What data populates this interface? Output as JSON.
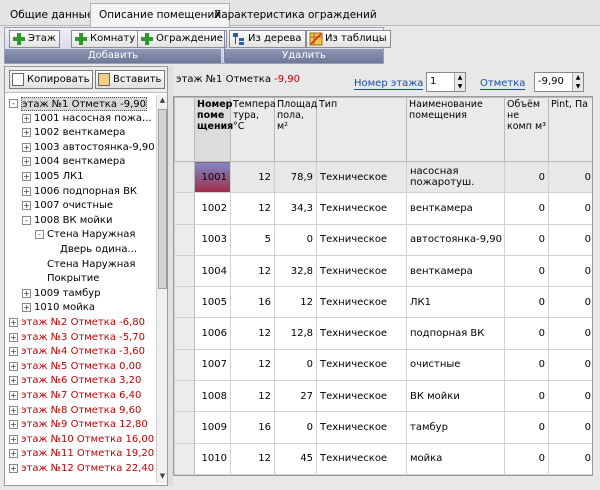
{
  "tabs": [
    {
      "label": "Общие данные"
    },
    {
      "label": "Описание помещений"
    },
    {
      "label": "Характеристика ограждений"
    }
  ],
  "ribbon": {
    "add_buttons": [
      "Этаж",
      "Комнату",
      "Ограждение"
    ],
    "add_group": "Добавить",
    "del_buttons": [
      "Из дерева",
      "Из таблицы"
    ],
    "del_group": "Удалить"
  },
  "left": {
    "copy": "Копировать",
    "paste": "Вставить"
  },
  "tree": [
    {
      "text": "этаж №1 Отметка -9,90",
      "red": false,
      "indent": 0,
      "exp": "-",
      "sel": true
    },
    {
      "text": "1001 насосная пожа...",
      "red": false,
      "indent": 1,
      "exp": "+"
    },
    {
      "text": "1002 венткамера",
      "red": false,
      "indent": 1,
      "exp": "+"
    },
    {
      "text": "1003 автостоянка-9,90",
      "red": false,
      "indent": 1,
      "exp": "+"
    },
    {
      "text": "1004 венткамера",
      "red": false,
      "indent": 1,
      "exp": "+"
    },
    {
      "text": "1005 ЛК1",
      "red": false,
      "indent": 1,
      "exp": "+"
    },
    {
      "text": "1006 подпорная ВК",
      "red": false,
      "indent": 1,
      "exp": "+"
    },
    {
      "text": "1007 очистные",
      "red": false,
      "indent": 1,
      "exp": "+"
    },
    {
      "text": "1008 ВК мойки",
      "red": false,
      "indent": 1,
      "exp": "-"
    },
    {
      "text": "Стена Наружная",
      "red": false,
      "indent": 2,
      "exp": "-"
    },
    {
      "text": "Дверь одина...",
      "red": false,
      "indent": 3,
      "exp": ""
    },
    {
      "text": "Стена Наружная",
      "red": false,
      "indent": 2,
      "exp": ""
    },
    {
      "text": "Покрытие",
      "red": false,
      "indent": 2,
      "exp": ""
    },
    {
      "text": "1009 тамбур",
      "red": false,
      "indent": 1,
      "exp": "+"
    },
    {
      "text": "1010 мойка",
      "red": false,
      "indent": 1,
      "exp": "+"
    },
    {
      "text": "этаж №2 Отметка -6,80",
      "red": true,
      "indent": 0,
      "exp": "+"
    },
    {
      "text": "этаж №3 Отметка -5,70",
      "red": true,
      "indent": 0,
      "exp": "+"
    },
    {
      "text": "этаж №4 Отметка -3,60",
      "red": true,
      "indent": 0,
      "exp": "+"
    },
    {
      "text": "этаж №5 Отметка 0,00",
      "red": true,
      "indent": 0,
      "exp": "+"
    },
    {
      "text": "этаж №6 Отметка 3,20",
      "red": true,
      "indent": 0,
      "exp": "+"
    },
    {
      "text": "этаж №7 Отметка 6,40",
      "red": true,
      "indent": 0,
      "exp": "+"
    },
    {
      "text": "этаж №8 Отметка 9,60",
      "red": true,
      "indent": 0,
      "exp": "+"
    },
    {
      "text": "этаж №9 Отметка 12,80",
      "red": true,
      "indent": 0,
      "exp": "+"
    },
    {
      "text": "этаж №10 Отметка 16,00",
      "red": true,
      "indent": 0,
      "exp": "+"
    },
    {
      "text": "этаж №11 Отметка 19,20",
      "red": true,
      "indent": 0,
      "exp": "+"
    },
    {
      "text": "этаж №12 Отметка 22,40",
      "red": true,
      "indent": 0,
      "exp": "+"
    }
  ],
  "info": {
    "floor_prefix": "этаж №1 Отметка",
    "floor_level": "-9,90",
    "floor_num_label": "Номер этажа",
    "floor_num_value": "1",
    "mark_label": "Отметка",
    "mark_value": "-9,90"
  },
  "grid": {
    "headers": [
      "Номер поме щения",
      "Темпера тура, °С",
      "Площад пола, м²",
      "Тип",
      "Наименование помещения",
      "Объём не комп м³",
      "Pint, Па"
    ],
    "rows": [
      [
        "1001",
        "12",
        "78,9",
        "Техническое",
        "насосная пожаротуш.",
        "0",
        "0"
      ],
      [
        "1002",
        "12",
        "34,3",
        "Техническое",
        "венткамера",
        "0",
        "0"
      ],
      [
        "1003",
        "5",
        "0",
        "Техническое",
        "автостоянка-9,90",
        "0",
        "0"
      ],
      [
        "1004",
        "12",
        "32,8",
        "Техническое",
        "венткамера",
        "0",
        "0"
      ],
      [
        "1005",
        "16",
        "12",
        "Техническое",
        "ЛК1",
        "0",
        "0"
      ],
      [
        "1006",
        "12",
        "12,8",
        "Техническое",
        "подпорная ВК",
        "0",
        "0"
      ],
      [
        "1007",
        "12",
        "0",
        "Техническое",
        "очистные",
        "0",
        "0"
      ],
      [
        "1008",
        "12",
        "27",
        "Техническое",
        "ВК мойки",
        "0",
        "0"
      ],
      [
        "1009",
        "16",
        "0",
        "Техническое",
        "тамбур",
        "0",
        "0"
      ],
      [
        "1010",
        "12",
        "45",
        "Техническое",
        "мойка",
        "0",
        "0"
      ]
    ]
  },
  "colors": {
    "accent_red": "#c00000",
    "ribbon_group": "#6d7796",
    "link_blue": "#1a4fa0"
  }
}
